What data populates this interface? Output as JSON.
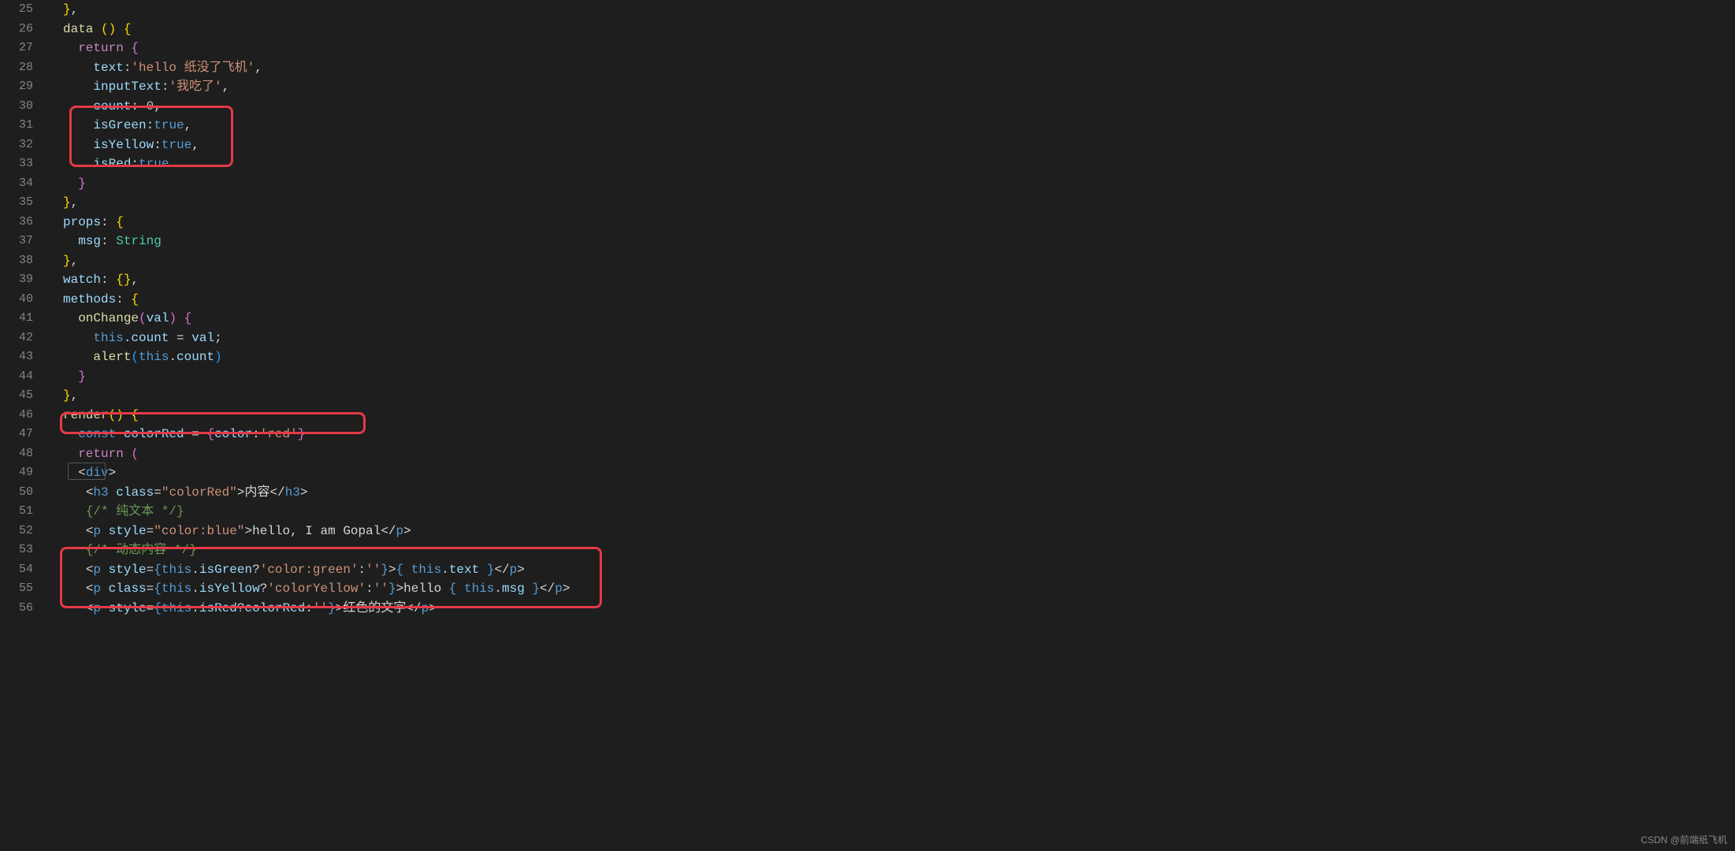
{
  "lineStart": 25,
  "lineEnd": 56,
  "code": {
    "l25": "},",
    "l26_data": "data",
    "l27_return": "return",
    "l28_text": "text",
    "l28_val": "'hello 纸没了飞机'",
    "l29_text": "inputText",
    "l29_val": "'我吃了'",
    "l30_text": "count",
    "l30_val": "0",
    "l31_text": "isGreen",
    "l31_val": "true",
    "l32_text": "isYellow",
    "l32_val": "true",
    "l33_text": "isRed",
    "l33_val": "true",
    "l36_props": "props",
    "l37_msg": "msg",
    "l37_type": "String",
    "l39_watch": "watch",
    "l40_methods": "methods",
    "l41_fn": "onChange",
    "l41_arg": "val",
    "l42_this": "this",
    "l42_count": "count",
    "l42_val": "val",
    "l43_alert": "alert",
    "l43_this": "this",
    "l43_count": "count",
    "l46_render": "render",
    "l47_const": "const",
    "l47_var": "colorRed",
    "l47_key": "color",
    "l47_val": "'red'",
    "l48_ret": "return",
    "l49_div": "div",
    "l50_tag": "h3",
    "l50_cls": "class",
    "l50_clsv": "\"colorRed\"",
    "l50_txt": "内容",
    "l51_cmt": "{/* 纯文本 */}",
    "l52_tag": "p",
    "l52_sty": "style",
    "l52_styv": "\"color:blue\"",
    "l52_txt": "hello, I am Gopal",
    "l53_cmt": "{/* 动态内容 */}",
    "l54_tag": "p",
    "l54_sty": "style",
    "l54_this": "this",
    "l54_prop": "isGreen",
    "l54_s1": "'color:green'",
    "l54_s2": "''",
    "l54_txt_this": "this",
    "l54_txt_prop": "text",
    "l55_tag": "p",
    "l55_cls": "class",
    "l55_this": "this",
    "l55_prop": "isYellow",
    "l55_s1": "'colorYellow'",
    "l55_s2": "''",
    "l55_txt": "hello ",
    "l55_txt_this": "this",
    "l55_txt_prop": "msg",
    "l56_tag": "p",
    "l56_sty": "style",
    "l56_this": "this",
    "l56_prop": "isRed",
    "l56_s1": "colorRed",
    "l56_s2": "''",
    "l56_txt": "红色的文字"
  },
  "watermark": "CSDN @前端纸飞机"
}
